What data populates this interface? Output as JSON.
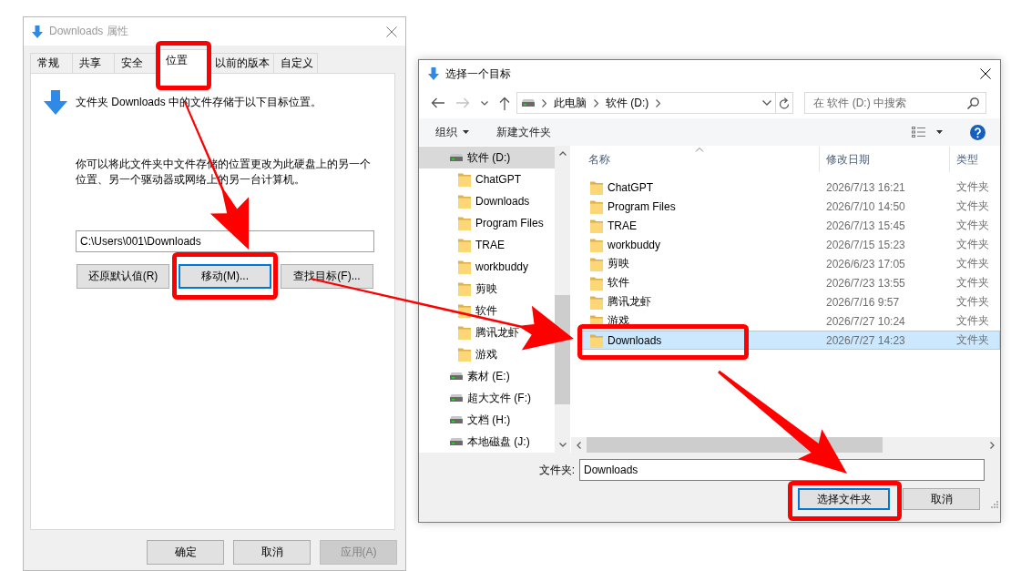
{
  "properties_dialog": {
    "title": "Downloads 属性",
    "focused": false,
    "tabs": [
      {
        "label": "常规",
        "selected": false,
        "highlighted": false
      },
      {
        "label": "共享",
        "selected": false,
        "highlighted": false
      },
      {
        "label": "安全",
        "selected": false,
        "highlighted": false
      },
      {
        "label": "位置",
        "selected": true,
        "highlighted": true
      },
      {
        "label": "以前的版本",
        "selected": false,
        "highlighted": false
      },
      {
        "label": "自定义",
        "selected": false,
        "highlighted": false
      }
    ],
    "heading": "文件夹 Downloads 中的文件存储于以下目标位置。",
    "description": "你可以将此文件夹中文件存储的位置更改为此硬盘上的另一个位置、另一个驱动器或网络上的另一台计算机。",
    "path_field": {
      "value": "C:\\Users\\001\\Downloads"
    },
    "buttons": [
      {
        "label": "还原默认值(R)",
        "focused": false,
        "highlighted": false
      },
      {
        "label": "移动(M)...",
        "focused": true,
        "highlighted": true
      },
      {
        "label": "查找目标(F)...",
        "focused": false,
        "highlighted": false
      }
    ],
    "footer_buttons": [
      {
        "label": "确定",
        "disabled": false
      },
      {
        "label": "取消",
        "disabled": false
      },
      {
        "label": "应用(A)",
        "disabled": true
      }
    ]
  },
  "folder_dialog": {
    "title": "选择一个目标",
    "focused": true,
    "nav_buttons": [
      {
        "kind": "back",
        "disabled": false
      },
      {
        "kind": "forward",
        "disabled": true
      },
      {
        "kind": "recent",
        "disabled": false
      },
      {
        "kind": "up",
        "disabled": false
      }
    ],
    "breadcrumb": [
      "此电脑",
      "软件 (D:)"
    ],
    "search": {
      "placeholder": "在 软件 (D:) 中搜索"
    },
    "toolbar": {
      "organize": "组织",
      "new_folder": "新建文件夹"
    },
    "nav_pane": [
      {
        "label": "软件 (D:)",
        "kind": "drive",
        "selected": true,
        "children": [
          {
            "label": "ChatGPT",
            "kind": "folder",
            "selected": false
          },
          {
            "label": "Downloads",
            "kind": "folder",
            "selected": false
          },
          {
            "label": "Program Files",
            "kind": "folder",
            "selected": false
          },
          {
            "label": "TRAE",
            "kind": "folder",
            "selected": false
          },
          {
            "label": "workbuddy",
            "kind": "folder",
            "selected": false
          },
          {
            "label": "剪映",
            "kind": "folder",
            "selected": false
          },
          {
            "label": "软件",
            "kind": "folder",
            "selected": false
          },
          {
            "label": "腾讯龙虾",
            "kind": "folder",
            "selected": false
          },
          {
            "label": "游戏",
            "kind": "folder",
            "selected": false
          }
        ]
      },
      {
        "label": "素材 (E:)",
        "kind": "drive",
        "selected": false
      },
      {
        "label": "超大文件 (F:)",
        "kind": "drive",
        "selected": false
      },
      {
        "label": "文档 (H:)",
        "kind": "drive",
        "selected": false
      },
      {
        "label": "本地磁盘 (J:)",
        "kind": "drive",
        "selected": false
      }
    ],
    "columns": [
      {
        "label": "名称",
        "sorted": true
      },
      {
        "label": "修改日期",
        "sorted": false
      },
      {
        "label": "类型",
        "sorted": false
      }
    ],
    "rows": [
      {
        "name": "ChatGPT",
        "modified": "2026/7/13 16:21",
        "type": "文件夹",
        "selected": false,
        "highlighted": false
      },
      {
        "name": "Program Files",
        "modified": "2026/7/10 14:50",
        "type": "文件夹",
        "selected": false,
        "highlighted": false
      },
      {
        "name": "TRAE",
        "modified": "2026/7/13 15:45",
        "type": "文件夹",
        "selected": false,
        "highlighted": false
      },
      {
        "name": "workbuddy",
        "modified": "2026/7/15 15:23",
        "type": "文件夹",
        "selected": false,
        "highlighted": false
      },
      {
        "name": "剪映",
        "modified": "2026/6/23 17:05",
        "type": "文件夹",
        "selected": false,
        "highlighted": false
      },
      {
        "name": "软件",
        "modified": "2026/7/23 13:55",
        "type": "文件夹",
        "selected": false,
        "highlighted": false
      },
      {
        "name": "腾讯龙虾",
        "modified": "2026/7/16 9:57",
        "type": "文件夹",
        "selected": false,
        "highlighted": false
      },
      {
        "name": "游戏",
        "modified": "2026/7/27 10:24",
        "type": "文件夹",
        "selected": false,
        "highlighted": false
      },
      {
        "name": "Downloads",
        "modified": "2026/7/27 14:23",
        "type": "文件夹",
        "selected": true,
        "highlighted": true
      }
    ],
    "folder_field": {
      "label": "文件夹:",
      "value": "Downloads"
    },
    "buttons": [
      {
        "label": "选择文件夹",
        "default": true,
        "highlighted": true
      },
      {
        "label": "取消",
        "default": false,
        "highlighted": false
      }
    ]
  }
}
